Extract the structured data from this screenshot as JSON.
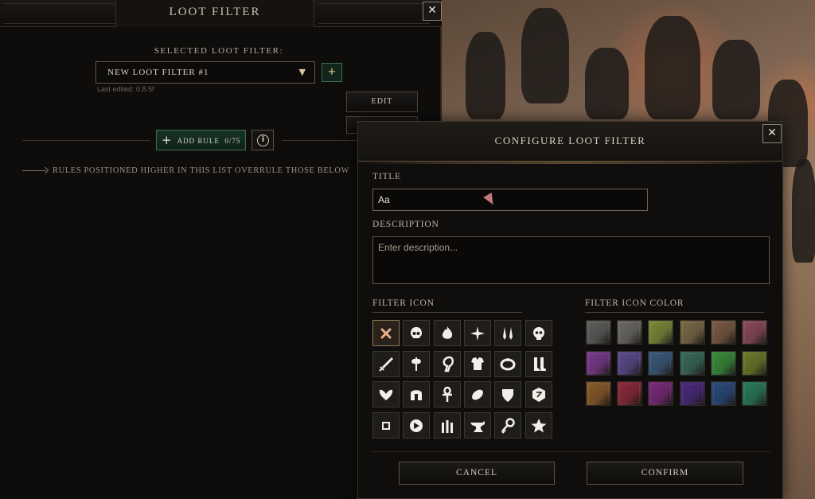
{
  "loot_panel": {
    "title": "LOOT FILTER",
    "selected_label": "SELECTED LOOT FILTER:",
    "selected_filter": "NEW LOOT FILTER #1",
    "last_edited": "Last edited: 0.8.5f",
    "edit_label": "EDIT",
    "add_rule_label": "ADD RULE",
    "rule_count": "0/75",
    "rules_note": "RULES POSITIONED HIGHER IN THIS LIST OVERRULE THOSE BELOW"
  },
  "modal": {
    "title": "CONFIGURE LOOT FILTER",
    "title_label": "TITLE",
    "title_value": "Aa",
    "description_label": "DESCRIPTION",
    "description_placeholder": "Enter description...",
    "filter_icon_label": "FILTER ICON",
    "filter_icon_color_label": "FILTER ICON COLOR",
    "cancel_label": "CANCEL",
    "confirm_label": "CONFIRM",
    "icons": [
      [
        "none-icon",
        "skull-icon",
        "flame-icon",
        "spark-icon",
        "twin-blades-icon",
        "demon-skull-icon"
      ],
      [
        "sword-icon",
        "double-axe-icon",
        "sickle-icon",
        "chest-armor-icon",
        "ring-icon",
        "boots-icon"
      ],
      [
        "gloves-icon",
        "helmet-icon",
        "ankh-icon",
        "gem-icon",
        "shield-icon",
        "rune-stone-icon"
      ],
      [
        "square-icon",
        "compass-icon",
        "potions-icon",
        "anvil-icon",
        "key-icon",
        "star-icon"
      ]
    ],
    "colors": [
      [
        "#5f5e5c",
        "#6c6a67",
        "#7a8a3a",
        "#7a6a48",
        "#7a5a44",
        "#8a4a5a"
      ],
      [
        "#7a3a8a",
        "#5a4a8a",
        "#3a5a7a",
        "#3a6a5a",
        "#3a8a3a",
        "#6a7a2a"
      ],
      [
        "#8a5a2a",
        "#8a2a3a",
        "#7a2a7a",
        "#4a2a7a",
        "#2a4a7a",
        "#2a7a5a"
      ]
    ]
  }
}
